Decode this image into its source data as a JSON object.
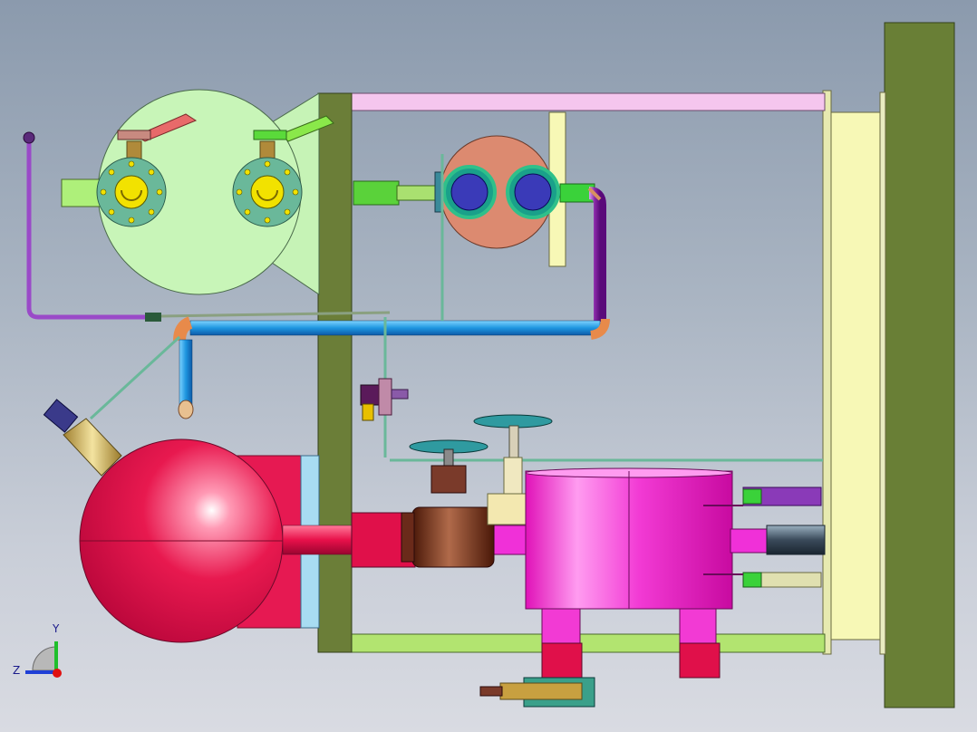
{
  "viewport": {
    "axis_triad": {
      "y_label": "Y",
      "z_label": "Z",
      "y_color": "#1fbf2b",
      "z_color": "#1f3fd6",
      "x_color": "#e01010"
    }
  },
  "colors": {
    "frame": "#6a7d3a",
    "receiver_tank": "#e01850",
    "heat_exchanger": "#f22fd0",
    "suction_pipe": "#2fa8e8",
    "discharge_pipe": "#9a3fb8",
    "condenser_plate": "#f6f7b8",
    "compressor_body": "#c8f5b8",
    "valve_handwheel": "#2f9aa0"
  }
}
